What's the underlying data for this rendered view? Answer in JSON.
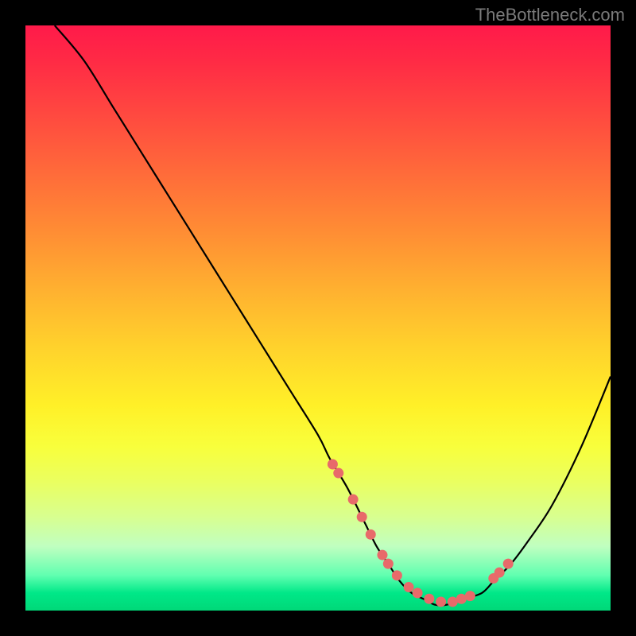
{
  "attribution": "TheBottleneck.com",
  "chart_data": {
    "type": "line",
    "title": "",
    "xlabel": "",
    "ylabel": "",
    "xlim": [
      0,
      100
    ],
    "ylim": [
      0,
      100
    ],
    "series": [
      {
        "name": "bottleneck-curve",
        "x": [
          5,
          10,
          15,
          20,
          25,
          30,
          35,
          40,
          45,
          50,
          52,
          55,
          58,
          60,
          62,
          64,
          66,
          68,
          70,
          72,
          75,
          78,
          80,
          83,
          86,
          90,
          95,
          100
        ],
        "y": [
          100,
          94,
          86,
          78,
          70,
          62,
          54,
          46,
          38,
          30,
          26,
          21,
          15,
          11,
          8,
          5,
          3,
          2,
          1,
          1,
          2,
          3,
          5,
          8,
          12,
          18,
          28,
          40
        ]
      }
    ],
    "markers": {
      "name": "highlight-dots",
      "x": [
        52.5,
        53.5,
        56,
        57.5,
        59,
        61,
        62,
        63.5,
        65.5,
        67,
        69,
        71,
        73,
        74.5,
        76,
        80,
        81,
        82.5
      ],
      "y": [
        25,
        23.5,
        19,
        16,
        13,
        9.5,
        8,
        6,
        4,
        3,
        2,
        1.5,
        1.5,
        2,
        2.5,
        5.5,
        6.5,
        8
      ]
    }
  }
}
